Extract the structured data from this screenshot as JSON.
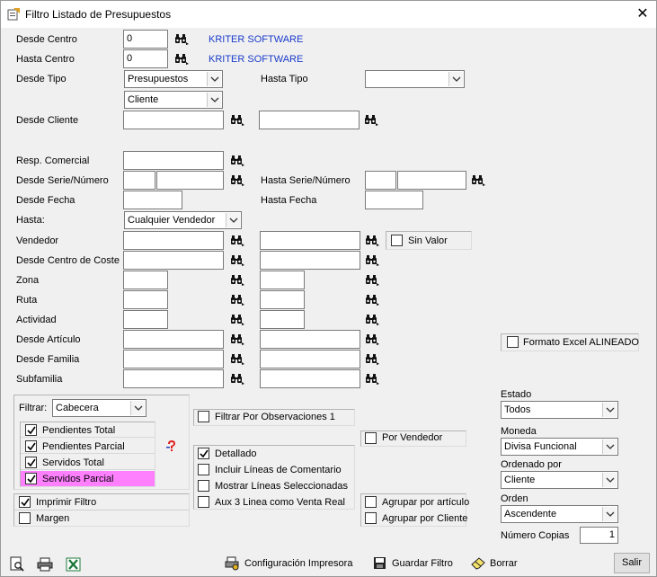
{
  "window": {
    "title": "Filtro Listado de Presupuestos",
    "close_symbol": "✕"
  },
  "rows": {
    "desde_centro": {
      "label": "Desde Centro",
      "value": "0",
      "company": "KRITER SOFTWARE"
    },
    "hasta_centro": {
      "label": "Hasta Centro",
      "value": "0",
      "company": "KRITER SOFTWARE"
    },
    "desde_tipo": {
      "label": "Desde Tipo",
      "value": "Presupuestos",
      "value2": "Cliente"
    },
    "hasta_tipo": {
      "label": "Hasta Tipo",
      "value": ""
    },
    "desde_cliente": {
      "label": "Desde Cliente"
    },
    "resp_comercial": {
      "label": "Resp. Comercial"
    },
    "desde_serie": {
      "label": "Desde Serie/Número"
    },
    "hasta_serie": {
      "label": "Hasta Serie/Número"
    },
    "desde_fecha": {
      "label": "Desde Fecha"
    },
    "hasta_fecha": {
      "label": "Hasta Fecha"
    },
    "hasta": {
      "label": "Hasta:",
      "value": "Cualquier Vendedor"
    },
    "vendedor": {
      "label": "Vendedor",
      "sin_valor": "Sin Valor"
    },
    "centro_coste": {
      "label": "Desde Centro de Coste"
    },
    "zona": {
      "label": "Zona"
    },
    "ruta": {
      "label": "Ruta"
    },
    "actividad": {
      "label": "Actividad"
    },
    "articulo": {
      "label": "Desde Artículo"
    },
    "familia": {
      "label": "Desde Familia"
    },
    "subfamilia": {
      "label": "Subfamilia"
    }
  },
  "formato_excel": {
    "label": "Formato Excel ALINEADO",
    "checked": false
  },
  "filtrar": {
    "label": "Filtrar:",
    "value": "Cabecera",
    "items": [
      {
        "label": "Pendientes Total",
        "checked": true
      },
      {
        "label": "Pendientes Parcial",
        "checked": true
      },
      {
        "label": "Servidos Total",
        "checked": true
      },
      {
        "label": "Servidos Parcial",
        "checked": true
      }
    ],
    "highlight_color": "#ff80ff"
  },
  "middle_checks": {
    "observaciones": {
      "label": "Filtrar Por Observaciones 1",
      "checked": false
    },
    "por_vendedor": {
      "label": "Por Vendedor",
      "checked": false
    },
    "detallado": {
      "label": "Detallado",
      "checked": true
    },
    "comentario": {
      "label": "Incluir Líneas de Comentario",
      "checked": false
    },
    "seleccionadas": {
      "label": "Mostrar Líneas Seleccionadas",
      "checked": false
    },
    "aux3": {
      "label": "Aux 3  Linea como Venta Real",
      "checked": false
    },
    "agrupar_articulo": {
      "label": "Agrupar por artículo",
      "checked": false
    },
    "agrupar_cliente": {
      "label": "Agrupar por Cliente",
      "checked": false
    }
  },
  "left_checks": {
    "imprimir_filtro": {
      "label": "Imprimir Filtro",
      "checked": true
    },
    "margen": {
      "label": "Margen",
      "checked": false
    }
  },
  "right_panel": {
    "estado": {
      "label": "Estado",
      "value": "Todos"
    },
    "moneda": {
      "label": "Moneda",
      "value": "Divisa Funcional"
    },
    "ordenado_por": {
      "label": "Ordenado por",
      "value": "Cliente"
    },
    "orden": {
      "label": "Orden",
      "value": "Ascendente"
    },
    "copias": {
      "label": "Número Copias",
      "value": "1"
    }
  },
  "toolbar": {
    "configuracion": "Configuración Impresora",
    "guardar": "Guardar Filtro",
    "borrar": "Borrar",
    "salir": "Salir"
  }
}
